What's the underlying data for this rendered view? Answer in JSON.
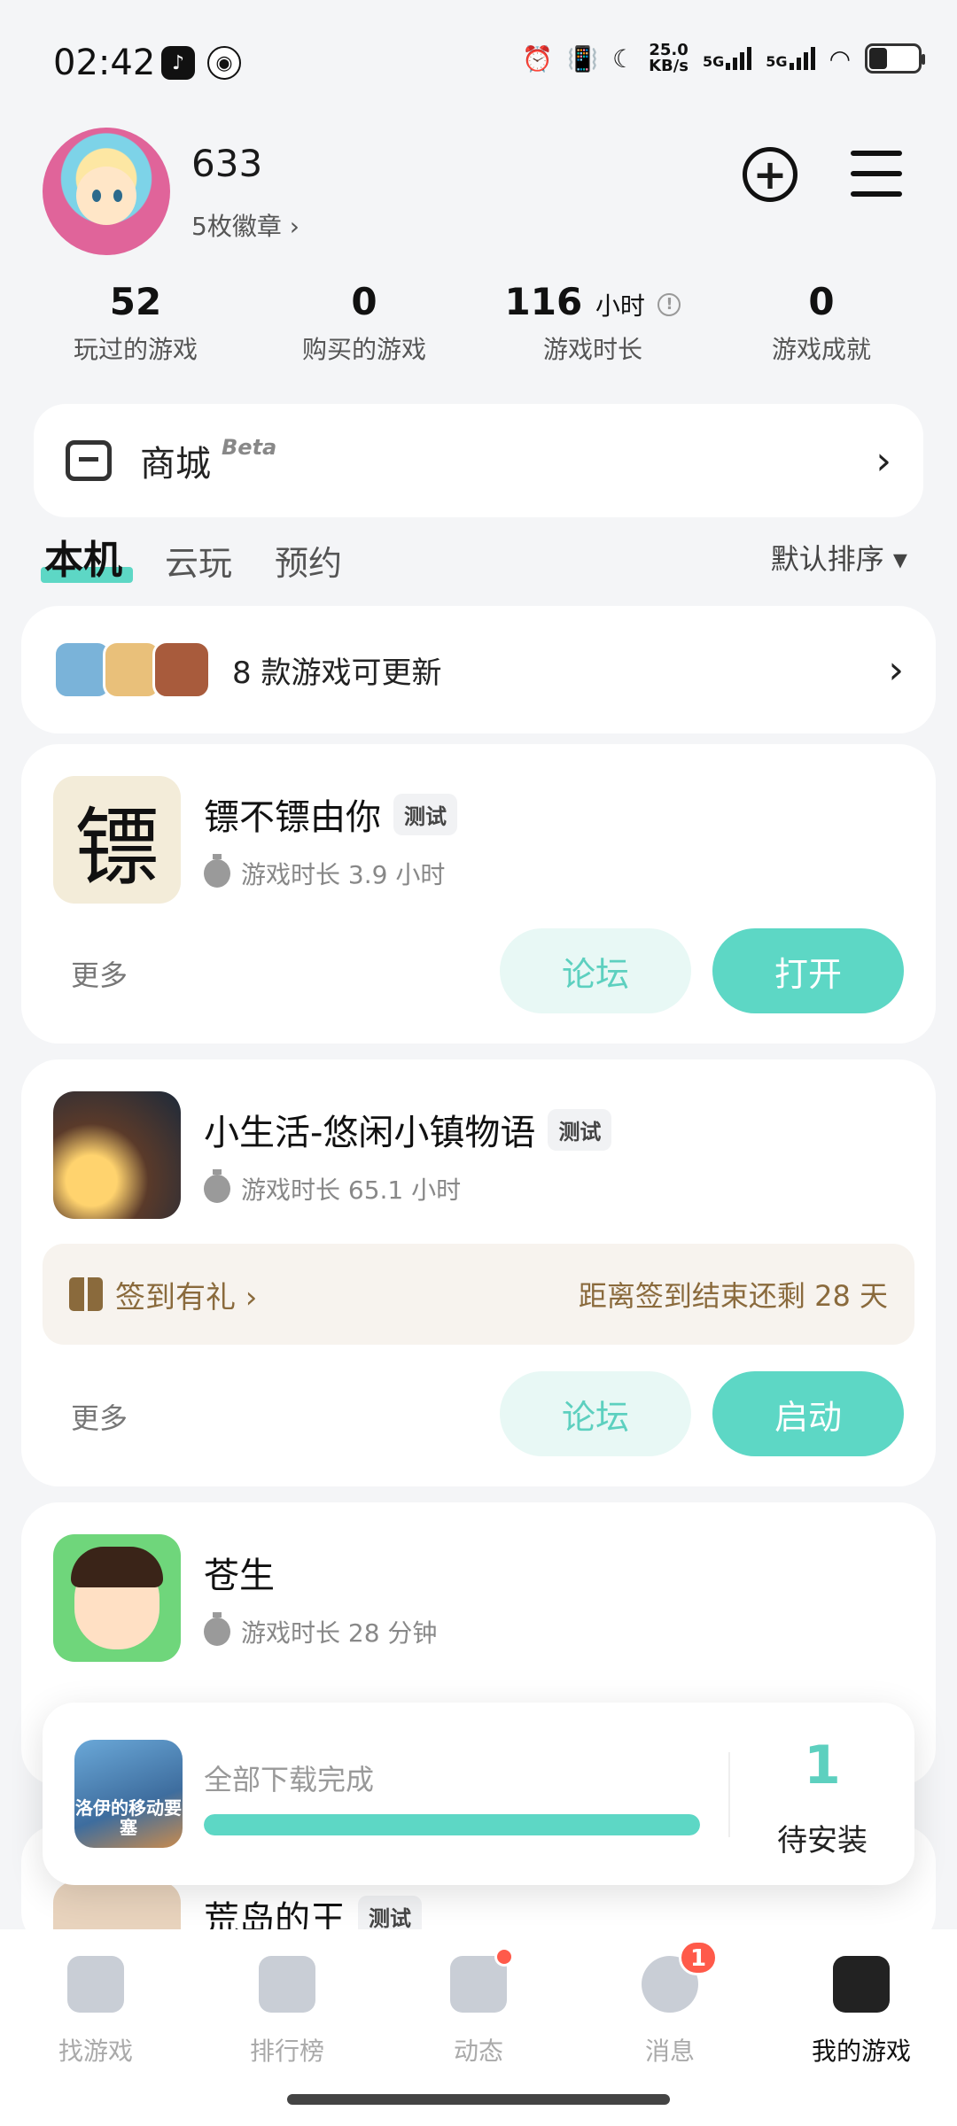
{
  "status_bar": {
    "time": "02:42",
    "net_speed_value": "25.0",
    "net_speed_unit": "KB/s",
    "sim1": "5G",
    "sim2": "5G"
  },
  "profile": {
    "username": "633",
    "badges": "5枚徽章 ›"
  },
  "stats": [
    {
      "value": "52",
      "unit": "",
      "label": "玩过的游戏"
    },
    {
      "value": "0",
      "unit": "",
      "label": "购买的游戏"
    },
    {
      "value": "116",
      "unit": "小时",
      "label": "游戏时长"
    },
    {
      "value": "0",
      "unit": "",
      "label": "游戏成就"
    }
  ],
  "store": {
    "label": "商城",
    "beta": "Beta"
  },
  "tabs": [
    {
      "label": "本机"
    },
    {
      "label": "云玩"
    },
    {
      "label": "预约"
    }
  ],
  "sort": "默认排序 ▾",
  "updates": {
    "label": "8 款游戏可更新"
  },
  "games": [
    {
      "title": "镖不镖由你",
      "tag": "测试",
      "playtime": "游戏时长 3.9 小时",
      "more": "更多",
      "forum": "论坛",
      "action": "打开",
      "icon_text": "镖"
    },
    {
      "title": "小生活-悠闲小镇物语",
      "tag": "测试",
      "playtime": "游戏时长 65.1 小时",
      "more": "更多",
      "forum": "论坛",
      "action": "启动",
      "checkin_label": "签到有礼 ›",
      "checkin_remaining": "距离签到结束还剩 28 天"
    },
    {
      "title": "苍生",
      "playtime": "游戏时长 28 分钟"
    },
    {
      "title": "荒岛的王",
      "tag": "测试"
    }
  ],
  "download": {
    "status": "全部下载完成",
    "progress": 1.0,
    "count": "1",
    "label": "待安装",
    "icon_text": "洛伊的移动要塞"
  },
  "nav": [
    {
      "label": "找游戏",
      "icon": "find-games-icon"
    },
    {
      "label": "排行榜",
      "icon": "ranking-icon"
    },
    {
      "label": "动态",
      "icon": "feed-icon"
    },
    {
      "label": "消息",
      "icon": "messages-icon",
      "badge": "1"
    },
    {
      "label": "我的游戏",
      "icon": "my-games-icon"
    }
  ],
  "colors": {
    "accent": "#5dd7c5",
    "accent_light": "#e8f8f5",
    "checkin_text": "#8a6a3c",
    "badge_red": "#ff5a4a"
  }
}
